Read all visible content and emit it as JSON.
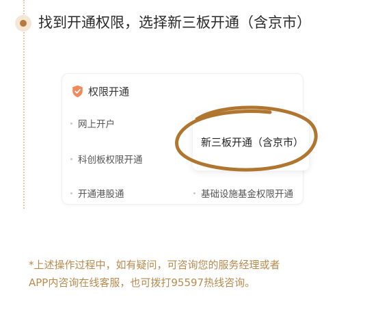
{
  "step": {
    "title": "找到开通权限，选择新三板开通（含京市）"
  },
  "card": {
    "title": "权限开通",
    "items": [
      {
        "label": "网上开户"
      },
      {
        "label": "科创板权限开通"
      },
      {
        "label": "开通港股通"
      },
      {
        "label": "新三板开通（含京市）"
      },
      {
        "label": "基础设施基金权限开通"
      }
    ]
  },
  "note": {
    "line1": "*上述操作过程中，如有疑问，可咨询您的服务经理或者",
    "line2": "APP内咨询在线客服，也可拨打95597热线咨询。"
  },
  "colors": {
    "accent": "#b77a3c",
    "highlight_circle": "#b0762f",
    "note_text": "#b78a4e",
    "shield": "#f08a5d"
  },
  "icons": {
    "card_header": "shield-icon"
  }
}
